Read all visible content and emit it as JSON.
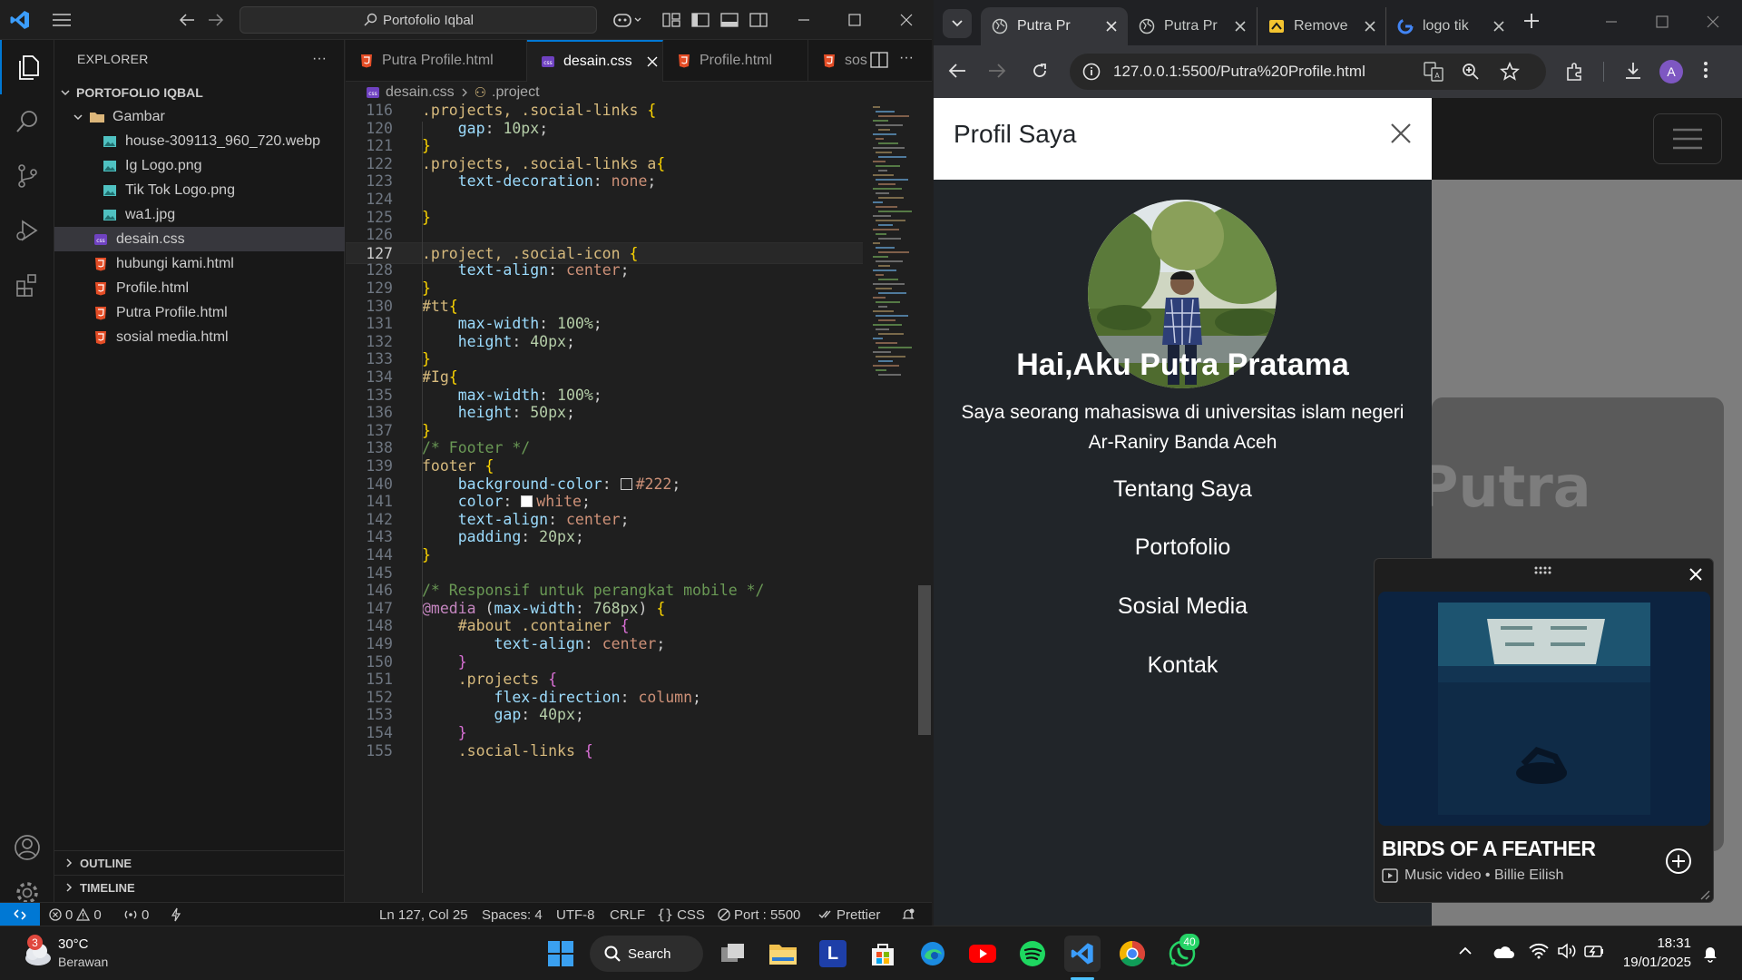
{
  "vscode": {
    "search": "Portofolio Iqbal",
    "explorer_title": "EXPLORER",
    "root_folder": "PORTOFOLIO IQBAL",
    "folder": "Gambar",
    "images": [
      "house-309113_960_720.webp",
      "Ig Logo.png",
      "Tik Tok Logo.png",
      "wa1.jpg"
    ],
    "files": [
      "desain.css",
      "hubungi kami.html",
      "Profile.html",
      "Putra Profile.html",
      "sosial media.html"
    ],
    "outline": "OUTLINE",
    "timeline": "TIMELINE",
    "tabs": [
      "Putra Profile.html",
      "desain.css",
      "Profile.html",
      "sos"
    ],
    "breadcrumb": {
      "file": "desain.css",
      "symbol": ".project"
    },
    "code_lines": [
      {
        "n": "116",
        "t": ".projects, .social-links {"
      },
      {
        "n": "120",
        "t": "    gap: 10px;"
      },
      {
        "n": "121",
        "t": "}"
      },
      {
        "n": "122",
        "t": ".projects, .social-links a{"
      },
      {
        "n": "123",
        "t": "    text-decoration: none;"
      },
      {
        "n": "124",
        "t": ""
      },
      {
        "n": "125",
        "t": "}"
      },
      {
        "n": "126",
        "t": ""
      },
      {
        "n": "127",
        "t": ".project, .social-icon {"
      },
      {
        "n": "128",
        "t": "    text-align: center;"
      },
      {
        "n": "129",
        "t": "}"
      },
      {
        "n": "130",
        "t": "#tt{"
      },
      {
        "n": "131",
        "t": "    max-width: 100%;"
      },
      {
        "n": "132",
        "t": "    height: 40px;"
      },
      {
        "n": "133",
        "t": "}"
      },
      {
        "n": "134",
        "t": "#Ig{"
      },
      {
        "n": "135",
        "t": "    max-width: 100%;"
      },
      {
        "n": "136",
        "t": "    height: 50px;"
      },
      {
        "n": "137",
        "t": "}"
      },
      {
        "n": "138",
        "t": "/* Footer */"
      },
      {
        "n": "139",
        "t": "footer {"
      },
      {
        "n": "140",
        "t": "    background-color: #222;"
      },
      {
        "n": "141",
        "t": "    color: white;"
      },
      {
        "n": "142",
        "t": "    text-align: center;"
      },
      {
        "n": "143",
        "t": "    padding: 20px;"
      },
      {
        "n": "144",
        "t": "}"
      },
      {
        "n": "145",
        "t": ""
      },
      {
        "n": "146",
        "t": "/* Responsif untuk perangkat mobile */"
      },
      {
        "n": "147",
        "t": "@media (max-width: 768px) {"
      },
      {
        "n": "148",
        "t": "    #about .container {"
      },
      {
        "n": "149",
        "t": "        text-align: center;"
      },
      {
        "n": "150",
        "t": "    }"
      },
      {
        "n": "151",
        "t": "    .projects {"
      },
      {
        "n": "152",
        "t": "        flex-direction: column;"
      },
      {
        "n": "153",
        "t": "        gap: 40px;"
      },
      {
        "n": "154",
        "t": "    }"
      },
      {
        "n": "155",
        "t": "    .social-links {"
      }
    ],
    "status": {
      "errors": "0",
      "warnings": "0",
      "ports": "0",
      "position": "Ln 127, Col 25",
      "spaces": "Spaces: 4",
      "encoding": "UTF-8",
      "eol": "CRLF",
      "language": "CSS",
      "port": "Port : 5500",
      "formatter": "Prettier"
    },
    "accent": "#0078d4"
  },
  "chrome": {
    "tabs": [
      "Putra Pr",
      "Putra Pr",
      "Remove",
      "logo tik"
    ],
    "url": "127.0.0.1:5500/Putra%20Profile.html",
    "profile_initial": "A",
    "page": {
      "panel_title": "Profil Saya",
      "heading": "Hai,Aku Putra Pratama",
      "bio": "Saya seorang mahasiswa di universitas islam negeri Ar-Raniry Banda Aceh",
      "nav": [
        "Tentang Saya",
        "Portofolio",
        "Sosial Media",
        "Kontak"
      ],
      "background_text": "Putra"
    },
    "miniplayer": {
      "title": "BIRDS OF A FEATHER",
      "subtitle": "Music video • Billie Eilish"
    }
  },
  "taskbar": {
    "weather_temp": "30°C",
    "weather_desc": "Berawan",
    "weather_badge": "3",
    "search": "Search",
    "whatsapp_badge": "40",
    "time": "18:31",
    "date": "19/01/2025"
  }
}
